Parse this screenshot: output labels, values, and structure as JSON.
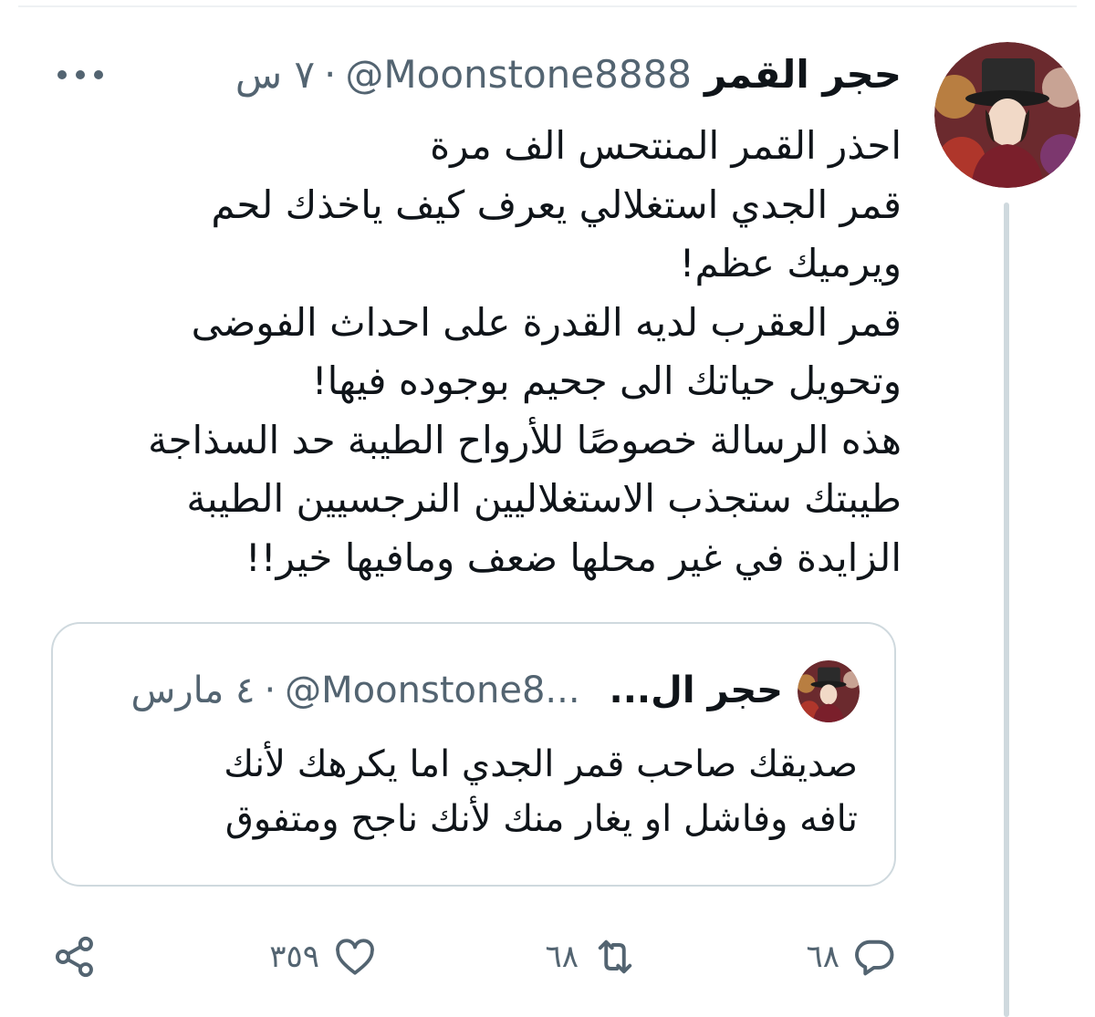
{
  "tweet": {
    "display_name": "حجر القمر",
    "handle": "@Moonstone8888",
    "separator": "·",
    "time": "٧ س",
    "text_lines": [
      "احذر القمر المنتحس الف مرة",
      "قمر الجدي استغلالي يعرف كيف ياخذك لحم",
      "ويرميك عظم!",
      "قمر العقرب لديه القدرة على احداث الفوضى",
      "وتحويل حياتك الى جحيم بوجوده فيها!",
      "هذه الرسالة خصوصًا للأرواح الطيبة حد السذاجة",
      "طيبتك ستجذب الاستغلاليين النرجسيين الطيبة",
      "الزايدة في غير محلها ضعف ومافيها خير!!"
    ]
  },
  "quoted_tweet": {
    "display_name": "حجر ال...",
    "handle": "@Moonstone8...",
    "separator": "·",
    "date": "٤ مارس",
    "text_lines": [
      "صديقك صاحب قمر الجدي اما يكرهك لأنك",
      "تافه وفاشل او يغار منك لأنك ناجح ومتفوق"
    ]
  },
  "actions": {
    "replies": "٦٨",
    "retweets": "٦٨",
    "likes": "٣٥٩"
  },
  "icons": {
    "more": "more-dots-icon",
    "reply": "reply-icon",
    "retweet": "retweet-icon",
    "like": "like-heart-icon",
    "share": "share-icon"
  },
  "colors": {
    "text_primary": "#0f1419",
    "text_secondary": "#536471",
    "border": "#cfd9de"
  }
}
